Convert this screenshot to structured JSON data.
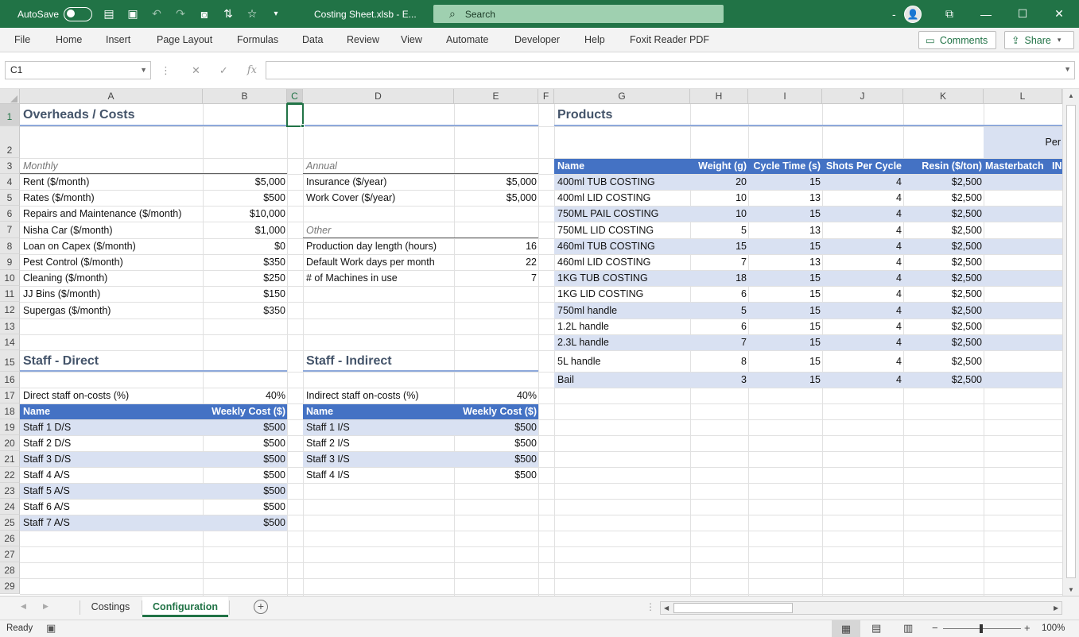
{
  "titlebar": {
    "autosave_label": "AutoSave",
    "file_title": "Costing Sheet.xlsb - E...",
    "search_placeholder": "Search"
  },
  "ribbon": {
    "tabs": [
      "File",
      "Home",
      "Insert",
      "Page Layout",
      "Formulas",
      "Data",
      "Review",
      "View",
      "Automate",
      "Developer",
      "Help",
      "Foxit Reader PDF"
    ],
    "comments_label": "Comments",
    "share_label": "Share"
  },
  "formula_bar": {
    "name_box": "C1",
    "fx_label": "fx",
    "formula": ""
  },
  "columns": [
    "A",
    "B",
    "C",
    "D",
    "E",
    "F",
    "G",
    "H",
    "I",
    "J",
    "K",
    "L"
  ],
  "rows": [
    "1",
    "2",
    "3",
    "4",
    "5",
    "6",
    "7",
    "8",
    "9",
    "10",
    "11",
    "12",
    "13",
    "14",
    "15",
    "16",
    "17",
    "18",
    "19",
    "20",
    "21",
    "22",
    "23",
    "24",
    "25",
    "26",
    "27",
    "28",
    "29"
  ],
  "overheads": {
    "title": "Overheads / Costs",
    "monthly_label": "Monthly",
    "items": [
      {
        "name": "Rent ($/month)",
        "value": "$5,000"
      },
      {
        "name": "Rates ($/month)",
        "value": "$500"
      },
      {
        "name": "Repairs and Maintenance ($/month)",
        "value": "$10,000"
      },
      {
        "name": "Nisha Car ($/month)",
        "value": "$1,000"
      },
      {
        "name": "Loan on Capex ($/month)",
        "value": "$0"
      },
      {
        "name": "Pest Control ($/month)",
        "value": "$350"
      },
      {
        "name": "Cleaning ($/month)",
        "value": "$250"
      },
      {
        "name": "JJ Bins ($/month)",
        "value": "$150"
      },
      {
        "name": "Supergas ($/month)",
        "value": "$350"
      }
    ],
    "annual_label": "Annual",
    "annual_items": [
      {
        "name": "Insurance ($/year)",
        "value": "$5,000"
      },
      {
        "name": "Work Cover ($/year)",
        "value": "$5,000"
      }
    ],
    "other_label": "Other",
    "other_items": [
      {
        "name": "Production day length (hours)",
        "value": "16"
      },
      {
        "name": "Default Work days per month",
        "value": "22"
      },
      {
        "name": "# of Machines in use",
        "value": "7"
      }
    ]
  },
  "staff_direct": {
    "title": "Staff - Direct",
    "oncost_label": "Direct staff on-costs (%)",
    "oncost_value": "40%",
    "header_name": "Name",
    "header_cost": "Weekly Cost ($)",
    "rows": [
      {
        "name": "Staff 1 D/S",
        "cost": "$500"
      },
      {
        "name": "Staff 2 D/S",
        "cost": "$500"
      },
      {
        "name": "Staff 3 D/S",
        "cost": "$500"
      },
      {
        "name": "Staff 4 A/S",
        "cost": "$500"
      },
      {
        "name": "Staff 5 A/S",
        "cost": "$500"
      },
      {
        "name": "Staff 6 A/S",
        "cost": "$500"
      },
      {
        "name": "Staff 7 A/S",
        "cost": "$500"
      }
    ]
  },
  "staff_indirect": {
    "title": "Staff - Indirect",
    "oncost_label": "Indirect staff on-costs (%)",
    "oncost_value": "40%",
    "header_name": "Name",
    "header_cost": "Weekly Cost ($)",
    "rows": [
      {
        "name": "Staff 1 I/S",
        "cost": "$500"
      },
      {
        "name": "Staff 2 I/S",
        "cost": "$500"
      },
      {
        "name": "Staff 3 I/S",
        "cost": "$500"
      },
      {
        "name": "Staff 4 I/S",
        "cost": "$500"
      }
    ]
  },
  "products": {
    "title": "Products",
    "per_label": "Per",
    "headers": [
      "Name",
      "Weight (g)",
      "Cycle Time (s)",
      "Shots Per Cycle",
      "Resin ($/ton)",
      "Masterbatch",
      "IN"
    ],
    "rows": [
      {
        "name": "400ml TUB COSTING",
        "weight": "20",
        "cycle": "15",
        "shots": "4",
        "resin": "$2,500"
      },
      {
        "name": "400ml LID COSTING",
        "weight": "10",
        "cycle": "13",
        "shots": "4",
        "resin": "$2,500"
      },
      {
        "name": "750ML PAIL COSTING",
        "weight": "10",
        "cycle": "15",
        "shots": "4",
        "resin": "$2,500"
      },
      {
        "name": "750ML LID COSTING",
        "weight": "5",
        "cycle": "13",
        "shots": "4",
        "resin": "$2,500"
      },
      {
        "name": "460ml TUB COSTING",
        "weight": "15",
        "cycle": "15",
        "shots": "4",
        "resin": "$2,500"
      },
      {
        "name": "460ml LID COSTING",
        "weight": "7",
        "cycle": "13",
        "shots": "4",
        "resin": "$2,500"
      },
      {
        "name": "1KG TUB COSTING",
        "weight": "18",
        "cycle": "15",
        "shots": "4",
        "resin": "$2,500"
      },
      {
        "name": "1KG LID COSTING",
        "weight": "6",
        "cycle": "15",
        "shots": "4",
        "resin": "$2,500"
      },
      {
        "name": "750ml handle",
        "weight": "5",
        "cycle": "15",
        "shots": "4",
        "resin": "$2,500"
      },
      {
        "name": "1.2L handle",
        "weight": "6",
        "cycle": "15",
        "shots": "4",
        "resin": "$2,500"
      },
      {
        "name": "2.3L handle",
        "weight": "7",
        "cycle": "15",
        "shots": "4",
        "resin": "$2,500"
      },
      {
        "name": "5L handle",
        "weight": "8",
        "cycle": "15",
        "shots": "4",
        "resin": "$2,500"
      },
      {
        "name": "Bail",
        "weight": "3",
        "cycle": "15",
        "shots": "4",
        "resin": "$2,500"
      }
    ]
  },
  "sheets": {
    "tabs": [
      "Costings",
      "Configuration"
    ],
    "active": "Configuration"
  },
  "status": {
    "ready": "Ready",
    "zoom": "100%"
  }
}
